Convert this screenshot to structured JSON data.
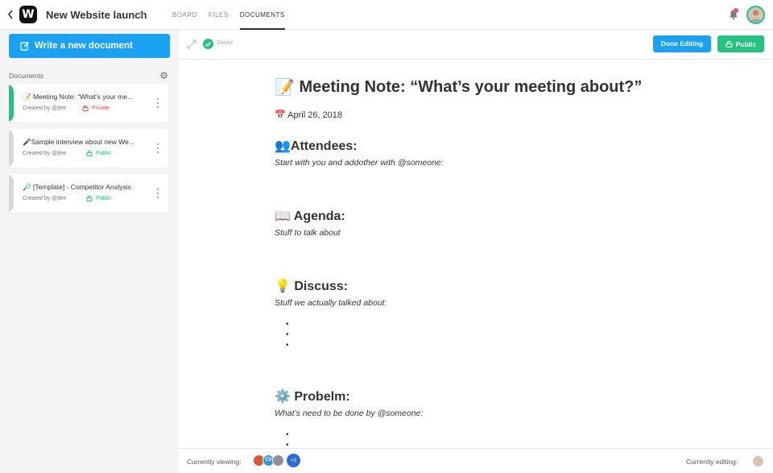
{
  "header": {
    "project_title": "New Website launch",
    "tabs": [
      {
        "label": "BOARD",
        "active": false
      },
      {
        "label": "FILES",
        "active": false
      },
      {
        "label": "DOCUMENTS",
        "active": true
      }
    ],
    "logo_letter": "W"
  },
  "sidebar": {
    "write_button_label": "Write a new document",
    "documents_label": "Documents",
    "documents": [
      {
        "icon": "📝",
        "title": "Meeting Note: “What’s your me...",
        "created_by": "Created by @jlee",
        "privacy": "Private",
        "privacy_color": "#e74c3c",
        "edge_color": "#26c281"
      },
      {
        "icon": "🎤",
        "title": "Sample interview about new We...",
        "created_by": "Created by @jlee",
        "privacy": "Public",
        "privacy_color": "#26c281",
        "edge_color": "#d6d6d6"
      },
      {
        "icon": "🔎",
        "title": "[Template] - Competitor Analysis",
        "created_by": "Created by @jlee",
        "privacy": "Public",
        "privacy_color": "#26c281",
        "edge_color": "#d6d6d6"
      }
    ]
  },
  "toolbar": {
    "saved_label": "Saved",
    "done_editing_label": "Done Editing",
    "public_label": "Public"
  },
  "document": {
    "title": "Meeting Note: “What’s your meeting about?”",
    "title_icon": "📝",
    "date_icon": "📅",
    "date": "April 26, 2018",
    "sections": [
      {
        "icon": "👥",
        "heading": "Attendees:",
        "text": "Start with you and addother with @someone:"
      },
      {
        "icon": "📖",
        "heading": "Agenda:",
        "text": "Stuff to talk about"
      },
      {
        "icon": "💡",
        "heading": "Discuss:",
        "text": "Stuff we actually talked about:"
      },
      {
        "icon": "⚙️",
        "heading": "Probelm:",
        "text": "What’s need to be done by @someone:"
      }
    ]
  },
  "footer": {
    "viewing_label": "Currently viewing:",
    "viewer_initials": "CV",
    "more_viewers": "+2",
    "editing_label": "Currently editing:"
  },
  "colors": {
    "primary": "#1ba1f2",
    "success": "#26c281",
    "danger": "#e74c3c"
  }
}
